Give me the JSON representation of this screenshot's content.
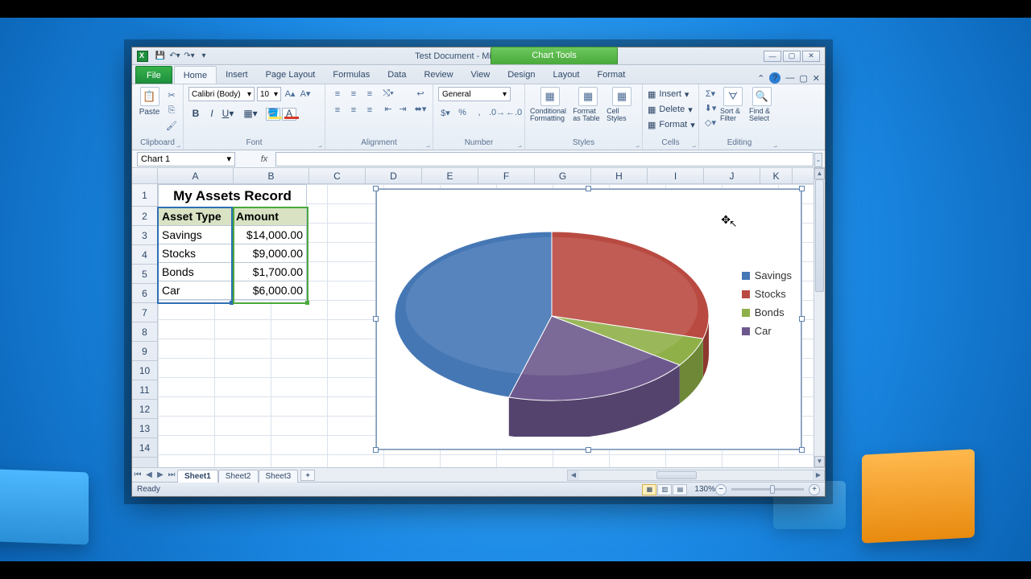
{
  "window": {
    "title": "Test Document - Microsoft Excel",
    "chart_tools_label": "Chart Tools"
  },
  "qat": {
    "icons": [
      "save",
      "undo",
      "redo"
    ]
  },
  "ribbon_tabs": {
    "file": "File",
    "items": [
      "Home",
      "Insert",
      "Page Layout",
      "Formulas",
      "Data",
      "Review",
      "View",
      "Design",
      "Layout",
      "Format"
    ],
    "active": "Home"
  },
  "ribbon": {
    "clipboard": {
      "label": "Clipboard",
      "paste": "Paste"
    },
    "font": {
      "label": "Font",
      "name": "Calibri (Body)",
      "size": "10"
    },
    "alignment": {
      "label": "Alignment"
    },
    "number": {
      "label": "Number",
      "format": "General"
    },
    "styles": {
      "label": "Styles",
      "cond": "Conditional Formatting",
      "table": "Format as Table",
      "cell": "Cell Styles"
    },
    "cells": {
      "label": "Cells",
      "insert": "Insert",
      "delete": "Delete",
      "format": "Format"
    },
    "editing": {
      "label": "Editing",
      "sort": "Sort & Filter",
      "find": "Find & Select"
    }
  },
  "namebox": "Chart 1",
  "columns": [
    "A",
    "B",
    "C",
    "D",
    "E",
    "F",
    "G",
    "H",
    "I",
    "J",
    "K"
  ],
  "rows": [
    "1",
    "2",
    "3",
    "4",
    "5",
    "6",
    "7",
    "8",
    "9",
    "10",
    "11",
    "12",
    "13",
    "14"
  ],
  "table": {
    "title": "My Assets Record",
    "headers": [
      "Asset Type",
      "Amount"
    ],
    "rows": [
      {
        "type": "Savings",
        "amount": "$14,000.00"
      },
      {
        "type": "Stocks",
        "amount": "$9,000.00"
      },
      {
        "type": "Bonds",
        "amount": "$1,700.00"
      },
      {
        "type": "Car",
        "amount": "$6,000.00"
      }
    ]
  },
  "sheet_tabs": {
    "items": [
      "Sheet1",
      "Sheet2",
      "Sheet3"
    ],
    "active": "Sheet1"
  },
  "status": {
    "text": "Ready",
    "zoom": "130%"
  },
  "legend": {
    "items": [
      {
        "label": "Savings",
        "color": "#4577b5"
      },
      {
        "label": "Stocks",
        "color": "#b94a41"
      },
      {
        "label": "Bonds",
        "color": "#8fb048"
      },
      {
        "label": "Car",
        "color": "#6d588d"
      }
    ]
  },
  "chart_data": {
    "type": "pie",
    "title": "",
    "categories": [
      "Savings",
      "Stocks",
      "Bonds",
      "Car"
    ],
    "values": [
      14000,
      9000,
      1700,
      6000
    ],
    "colors": [
      "#4577b5",
      "#b94a41",
      "#8fb048",
      "#6d588d"
    ],
    "dark_colors": [
      "#335a8d",
      "#8f3731",
      "#6e8837",
      "#53436d"
    ],
    "style": "3d"
  }
}
